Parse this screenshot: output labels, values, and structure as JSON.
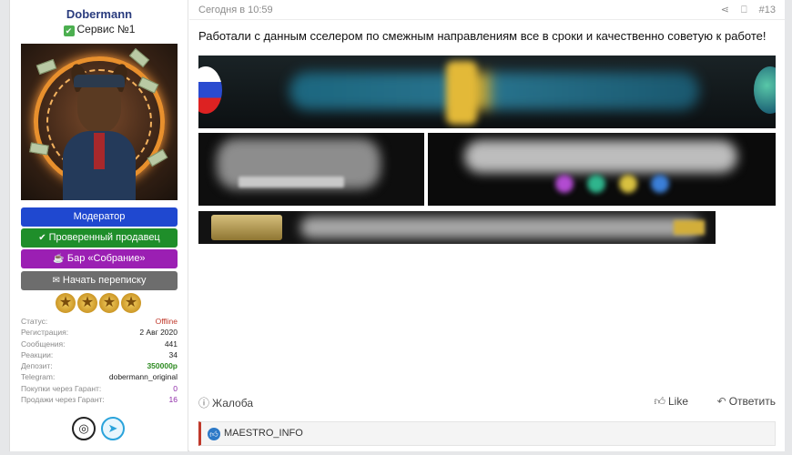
{
  "user": {
    "name": "Dobermann",
    "title": "Сервис №1",
    "buttons": {
      "moderator": "Модератор",
      "verified": "Проверенный продавец",
      "bar": "Бар «Собрание»",
      "message": "Начать переписку"
    },
    "stars": 4,
    "stats": [
      {
        "key": "Статус:",
        "value": "Offline",
        "style": "red"
      },
      {
        "key": "Регистрация:",
        "value": "2 Авг 2020",
        "style": ""
      },
      {
        "key": "Сообщения:",
        "value": "441",
        "style": ""
      },
      {
        "key": "Реакции:",
        "value": "34",
        "style": ""
      },
      {
        "key": "Депозит:",
        "value": "350000р",
        "style": "green"
      },
      {
        "key": "Telegram:",
        "value": "dobermann_original",
        "style": ""
      },
      {
        "key": "Покупки через Гарант:",
        "value": "0",
        "style": "purple"
      },
      {
        "key": "Продажи через Гарант:",
        "value": "16",
        "style": "purple"
      }
    ],
    "socials": [
      "fingerprint-icon",
      "telegram-icon"
    ]
  },
  "post": {
    "date": "Сегодня в 10:59",
    "number": "#13",
    "text": "Работали с данным сселером по смежным направлениям все в сроки и качественно советую к работе!",
    "report_label": "Жалоба",
    "like_label": "Like",
    "reply_label": "Ответить",
    "reactions": {
      "user": "MAESTRO_INFO"
    }
  },
  "colors": {
    "moderator": "#1f48d0",
    "verified": "#1f8e2a",
    "bar": "#9b1fb3",
    "message": "#6d6d6d",
    "username": "#2a3c7e"
  }
}
